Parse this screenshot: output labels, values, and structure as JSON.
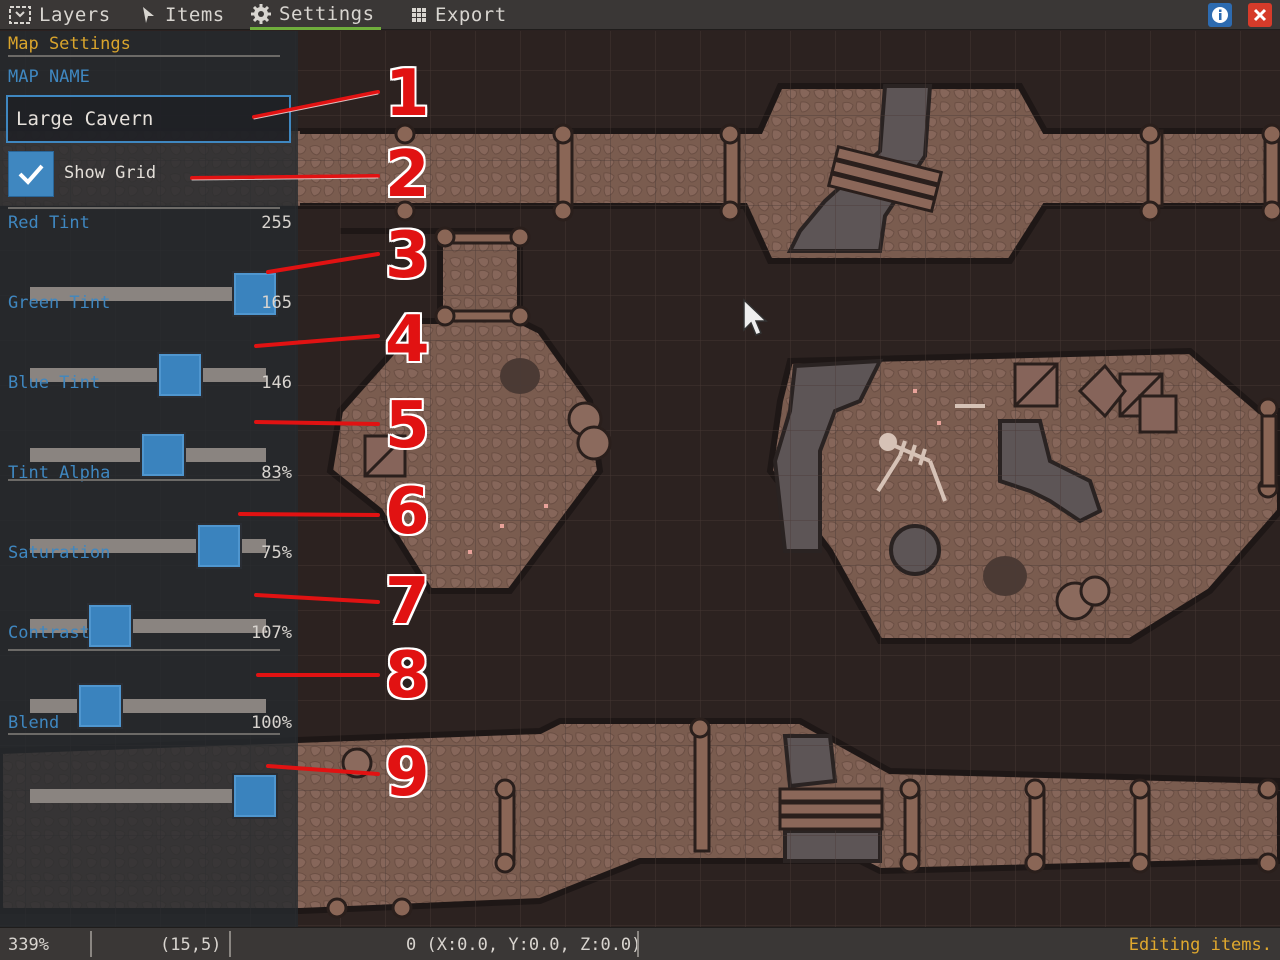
{
  "menu": {
    "tabs": [
      {
        "label": "Layers",
        "icon": "layers-icon"
      },
      {
        "label": "Items",
        "icon": "pointer-icon"
      },
      {
        "label": "Settings",
        "icon": "gear-icon",
        "active": true
      },
      {
        "label": "Export",
        "icon": "grid-icon"
      }
    ],
    "info_icon": "info-icon",
    "close_icon": "close-icon"
  },
  "panel": {
    "section_title": "Map Settings",
    "map_name_label": "MAP NAME",
    "map_name_value": "Large Cavern",
    "show_grid_label": "Show Grid",
    "show_grid_checked": true,
    "sliders": [
      {
        "label": "Red Tint",
        "value_text": "255",
        "level": 1.0
      },
      {
        "label": "Green Tint",
        "value_text": "165",
        "level": 0.65
      },
      {
        "label": "Blue Tint",
        "value_text": "146",
        "level": 0.57
      },
      {
        "label": "Tint Alpha",
        "value_text": "83%",
        "level": 0.83
      },
      {
        "label": "Saturation",
        "value_text": "75%",
        "level": 0.32
      },
      {
        "label": "Contrast",
        "value_text": "107%",
        "level": 0.27
      },
      {
        "label": "Blend",
        "value_text": "100%",
        "level": 1.0
      }
    ]
  },
  "callouts": [
    "1",
    "2",
    "3",
    "4",
    "5",
    "6",
    "7",
    "8",
    "9"
  ],
  "status": {
    "zoom": "339%",
    "cell": "(15,5)",
    "position": "0 (X:0.0, Y:0.0, Z:0.0)",
    "message": "Editing items."
  },
  "colors": {
    "accent_blue": "#3f87c0",
    "section_gold": "#d9a42c",
    "active_tab_underline": "#6fae3c",
    "callout_red": "#e11212",
    "floor": "#7a5a4c",
    "cave_wall": "#2c2220",
    "water": "#5d5556"
  }
}
